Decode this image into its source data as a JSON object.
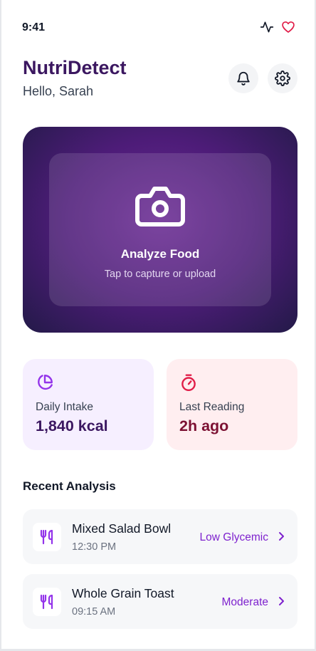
{
  "status_bar": {
    "time": "9:41",
    "icons": [
      "activity-icon",
      "heart-icon"
    ]
  },
  "header": {
    "title": "NutriDetect",
    "greeting": "Hello, Sarah",
    "buttons": [
      "bell-icon",
      "gear-icon"
    ]
  },
  "hero": {
    "icon": "camera-icon",
    "title": "Analyze Food",
    "subtitle": "Tap to capture or upload"
  },
  "stats": [
    {
      "icon": "pie-chart-icon",
      "label": "Daily Intake",
      "value": "1,840 kcal",
      "accent": "#9333ea"
    },
    {
      "icon": "timer-icon",
      "label": "Last Reading",
      "value": "2h ago",
      "accent": "#e11d48"
    }
  ],
  "recent": {
    "title": "Recent Analysis",
    "items": [
      {
        "icon": "utensils-icon",
        "name": "Mixed Salad Bowl",
        "time": "12:30 PM",
        "tag": "Low Glycemic"
      },
      {
        "icon": "utensils-icon",
        "name": "Whole Grain Toast",
        "time": "09:15 AM",
        "tag": "Moderate"
      }
    ]
  },
  "colors": {
    "brand": "#3b1760",
    "accent": "#7e22ce",
    "hero_gradient_start": "#6a2a93",
    "hero_gradient_end": "#231a48",
    "heart": "#e11d48"
  }
}
